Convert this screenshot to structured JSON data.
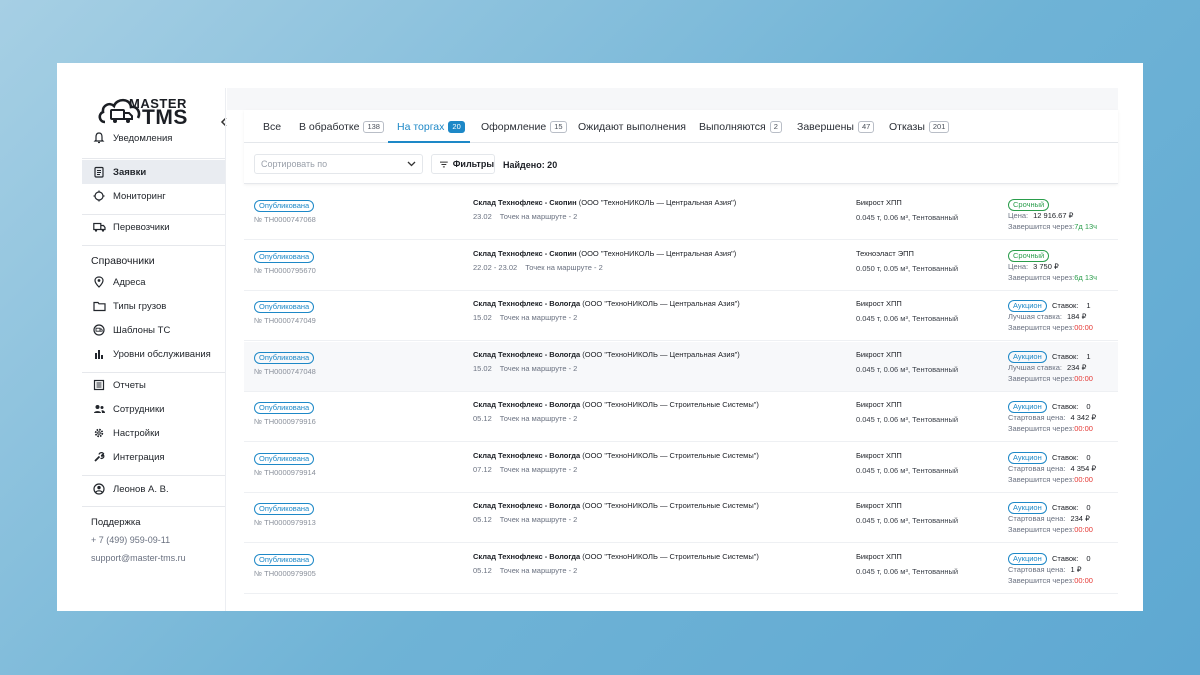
{
  "brand": {
    "line1": "MASTER",
    "line2": "TMS"
  },
  "sidebar": {
    "notifications": "Уведомления",
    "requests": "Заявки",
    "monitoring": "Мониторинг",
    "carriers": "Перевозчики",
    "reference_title": "Справочники",
    "addresses": "Адреса",
    "cargo_types": "Типы грузов",
    "vehicle_templates": "Шаблоны ТС",
    "service_levels": "Уровни обслуживания",
    "reports": "Отчеты",
    "employees": "Сотрудники",
    "settings": "Настройки",
    "integration": "Интеграция",
    "user": "Леонов А. В.",
    "support_title": "Поддержка",
    "support_phone": "+ 7 (499) 959-09-11",
    "support_email": "support@master-tms.ru"
  },
  "tabs": [
    {
      "label": "Все",
      "count": ""
    },
    {
      "label": "В обработке",
      "count": "138"
    },
    {
      "label": "На торгах",
      "count": "20"
    },
    {
      "label": "Оформление",
      "count": "15"
    },
    {
      "label": "Ожидают выполнения",
      "count": ""
    },
    {
      "label": "Выполняются",
      "count": "2"
    },
    {
      "label": "Завершены",
      "count": "47"
    },
    {
      "label": "Отказы",
      "count": "201"
    }
  ],
  "toolbar": {
    "sort_placeholder": "Сортировать по",
    "filters_label": "Фильтры",
    "found_text": "Найдено: 20"
  },
  "accent_color": "#1d88c7",
  "orders": [
    {
      "status": "Опубликована",
      "number": "№ ТН0000747068",
      "route_bold": "Склад Технофлекс - Скопин",
      "route_company": "(ООО \"ТехноНИКОЛЬ — Центральная Азия\")",
      "dates": "23.02",
      "points": "Точек на маршруте - 2",
      "cargo": "Бикрост ХПП",
      "cargo_spec": "0.045 т, 0.06 м³, Тентованный",
      "tag": "Срочный",
      "tag_type": "urgent",
      "bids_label": "",
      "bids_value": "",
      "price_label": "Цена:",
      "price_value": "12 916.67 ₽",
      "ends_label": "Завершится через:",
      "ends_value": "7д 13ч",
      "ends_color": "green"
    },
    {
      "status": "Опубликована",
      "number": "№ ТН0000795670",
      "route_bold": "Склад Технофлекс - Скопин",
      "route_company": "(ООО \"ТехноНИКОЛЬ — Центральная Азия\")",
      "dates": "22.02 - 23.02",
      "points": "Точек на маршруте - 2",
      "cargo": "Техноэласт ЭПП",
      "cargo_spec": "0.050 т, 0.05 м³, Тентованный",
      "tag": "Срочный",
      "tag_type": "urgent",
      "bids_label": "",
      "bids_value": "",
      "price_label": "Цена:",
      "price_value": "3 750 ₽",
      "ends_label": "Завершится через:",
      "ends_value": "6д 13ч",
      "ends_color": "green"
    },
    {
      "status": "Опубликована",
      "number": "№ ТН0000747049",
      "route_bold": "Склад Технофлекс - Вологда",
      "route_company": "(ООО \"ТехноНИКОЛЬ — Центральная Азия\")",
      "dates": "15.02",
      "points": "Точек на маршруте - 2",
      "cargo": "Бикрост ХПП",
      "cargo_spec": "0.045 т, 0.06 м³, Тентованный",
      "tag": "Аукцион",
      "tag_type": "auction",
      "bids_label": "Ставок:",
      "bids_value": "1",
      "price_label": "Лучшая ставка:",
      "price_value": "184 ₽",
      "ends_label": "Завершится через:",
      "ends_value": "00:00",
      "ends_color": "red"
    },
    {
      "status": "Опубликована",
      "number": "№ ТН0000747048",
      "route_bold": "Склад Технофлекс - Вологда",
      "route_company": "(ООО \"ТехноНИКОЛЬ — Центральная Азия\")",
      "dates": "15.02",
      "points": "Точек на маршруте - 2",
      "cargo": "Бикрост ХПП",
      "cargo_spec": "0.045 т, 0.06 м³, Тентованный",
      "tag": "Аукцион",
      "tag_type": "auction",
      "bids_label": "Ставок:",
      "bids_value": "1",
      "price_label": "Лучшая ставка:",
      "price_value": "234 ₽",
      "ends_label": "Завершится через:",
      "ends_value": "00:00",
      "ends_color": "red"
    },
    {
      "status": "Опубликована",
      "number": "№ ТН0000979916",
      "route_bold": "Склад Технофлекс - Вологда",
      "route_company": "(ООО \"ТехноНИКОЛЬ — Строительные Системы\")",
      "dates": "05.12",
      "points": "Точек на маршруте - 2",
      "cargo": "Бикрост ХПП",
      "cargo_spec": "0.045 т, 0.06 м³, Тентованный",
      "tag": "Аукцион",
      "tag_type": "auction",
      "bids_label": "Ставок:",
      "bids_value": "0",
      "price_label": "Стартовая цена:",
      "price_value": "4 342 ₽",
      "ends_label": "Завершится через:",
      "ends_value": "00:00",
      "ends_color": "red"
    },
    {
      "status": "Опубликована",
      "number": "№ ТН0000979914",
      "route_bold": "Склад Технофлекс - Вологда",
      "route_company": "(ООО \"ТехноНИКОЛЬ — Строительные Системы\")",
      "dates": "07.12",
      "points": "Точек на маршруте - 2",
      "cargo": "Бикрост ХПП",
      "cargo_spec": "0.045 т, 0.06 м³, Тентованный",
      "tag": "Аукцион",
      "tag_type": "auction",
      "bids_label": "Ставок:",
      "bids_value": "0",
      "price_label": "Стартовая цена:",
      "price_value": "4 354 ₽",
      "ends_label": "Завершится через:",
      "ends_value": "00:00",
      "ends_color": "red"
    },
    {
      "status": "Опубликована",
      "number": "№ ТН0000979913",
      "route_bold": "Склад Технофлекс - Вологда",
      "route_company": "(ООО \"ТехноНИКОЛЬ — Строительные Системы\")",
      "dates": "05.12",
      "points": "Точек на маршруте - 2",
      "cargo": "Бикрост ХПП",
      "cargo_spec": "0.045 т, 0.06 м³, Тентованный",
      "tag": "Аукцион",
      "tag_type": "auction",
      "bids_label": "Ставок:",
      "bids_value": "0",
      "price_label": "Стартовая цена:",
      "price_value": "234 ₽",
      "ends_label": "Завершится через:",
      "ends_value": "00:00",
      "ends_color": "red"
    },
    {
      "status": "Опубликована",
      "number": "№ ТН0000979905",
      "route_bold": "Склад Технофлекс - Вологда",
      "route_company": "(ООО \"ТехноНИКОЛЬ — Строительные Системы\")",
      "dates": "05.12",
      "points": "Точек на маршруте - 2",
      "cargo": "Бикрост ХПП",
      "cargo_spec": "0.045 т, 0.06 м³, Тентованный",
      "tag": "Аукцион",
      "tag_type": "auction",
      "bids_label": "Ставок:",
      "bids_value": "0",
      "price_label": "Стартовая цена:",
      "price_value": "1 ₽",
      "ends_label": "Завершится через:",
      "ends_value": "00:00",
      "ends_color": "red"
    }
  ]
}
